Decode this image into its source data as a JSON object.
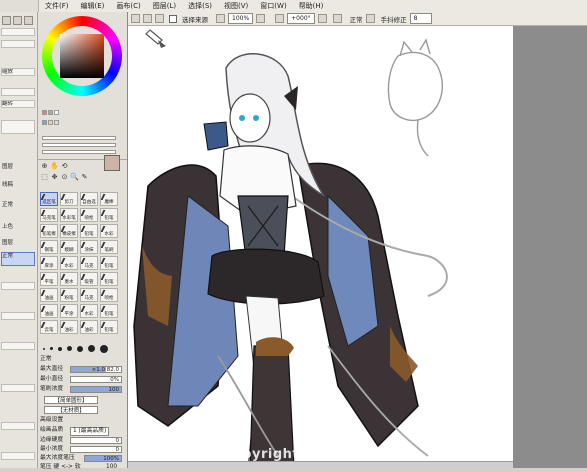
{
  "menu": {
    "items": [
      "文件(F)",
      "编辑(E)",
      "画布(C)",
      "图层(L)",
      "选择(S)",
      "视图(V)",
      "窗口(W)",
      "帮助(H)"
    ]
  },
  "options": {
    "selection_label": "选择来源",
    "zoom": "100%",
    "angle": "+000°",
    "stabilizer_label": "手抖修正",
    "stabilizer_value": "8",
    "mode_label": "正常"
  },
  "navigator": {
    "rows": [
      "",
      "",
      "缩放",
      "",
      "翻转"
    ]
  },
  "layers": {
    "items": [
      "图层",
      "线稿",
      "正常",
      "上色",
      "图层",
      "",
      "",
      "正常",
      "",
      ""
    ]
  },
  "brushes": {
    "rows": [
      [
        "选区笔",
        "剪刀",
        "自由选",
        "魔棒"
      ],
      [
        "马克笔",
        "水彩笔",
        "喷枪",
        "铅笔"
      ],
      [
        "铅笔擦",
        "橡皮擦",
        "铅笔",
        "水彩"
      ],
      [
        "钢笔",
        "模糊",
        "涂抹",
        "笔刷"
      ],
      [
        "厚涂",
        "水彩",
        "马克",
        "铅笔"
      ],
      [
        "平笔",
        "墨水",
        "吸管",
        "铅笔"
      ],
      [
        "油画",
        "粉笔",
        "马克",
        "喷枪"
      ],
      [
        "油画",
        "平涂",
        "水彩",
        "铅笔"
      ],
      [
        "云笔",
        "油彩",
        "油彩",
        "铅笔"
      ]
    ],
    "active_index": 0
  },
  "brush_props": {
    "blend_label": "正常",
    "size_label": "最大直径",
    "size_value": "×1.0  82.0",
    "min_size_label": "最小直径",
    "min_size_value": "0%",
    "density_label": "笔刷浓度",
    "density_value": "100",
    "shape_label": "【简单圆形】",
    "texture_label": "【无材质】",
    "advanced_label": "高级设置",
    "quality_label": "绘画品质",
    "quality_value": "1 (最高品质)",
    "edge_label": "边缘硬度",
    "edge_value": "0",
    "min_density_label": "最小浓度",
    "min_density_value": "0",
    "max_pressure_label": "最大浓度笔压",
    "max_pressure_value": "100%",
    "pressure_label": "笔压 硬 <-> 软",
    "pressure_value": "100",
    "checks": [
      "浓度",
      "直径",
      "混色"
    ]
  },
  "canvas": {
    "watermark": "com Copyright Design Art"
  },
  "colors": {
    "ui_bg": "#e3e0d9",
    "accent": "#4a68bd",
    "canvas_bg": "#ffffff",
    "workspace": "#878787"
  }
}
